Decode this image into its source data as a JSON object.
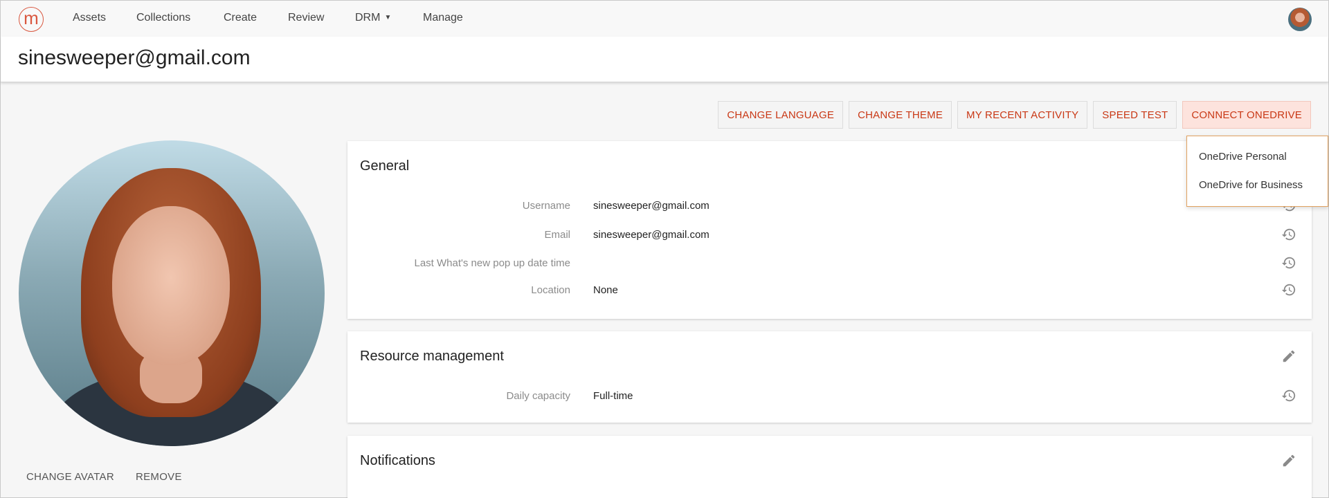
{
  "nav": {
    "logo_letter": "m",
    "items": [
      "Assets",
      "Collections",
      "Create",
      "Review",
      "DRM",
      "Manage"
    ]
  },
  "header": {
    "title": "sinesweeper@gmail.com"
  },
  "actions": [
    "CHANGE LANGUAGE",
    "CHANGE THEME",
    "MY RECENT ACTIVITY",
    "SPEED TEST",
    "CONNECT ONEDRIVE"
  ],
  "dropdown": {
    "items": [
      "OneDrive Personal",
      "OneDrive for Business"
    ]
  },
  "avatar": {
    "change_label": "CHANGE AVATAR",
    "remove_label": "REMOVE"
  },
  "general": {
    "title": "General",
    "fields": [
      {
        "label": "Username",
        "value": "sinesweeper@gmail.com"
      },
      {
        "label": "Email",
        "value": "sinesweeper@gmail.com"
      },
      {
        "label": "Last What's new pop up date time",
        "value": ""
      },
      {
        "label": "Location",
        "value": "None"
      }
    ]
  },
  "resource": {
    "title": "Resource management",
    "fields": [
      {
        "label": "Daily capacity",
        "value": "Full-time"
      }
    ]
  },
  "notifications": {
    "title": "Notifications"
  },
  "colors": {
    "accent": "#c93815",
    "active_button_bg": "#fde3dd",
    "dropdown_border": "#e1a15f"
  },
  "icons": {
    "history": "history-icon",
    "edit": "pencil-icon",
    "caret": "caret-down-icon"
  }
}
